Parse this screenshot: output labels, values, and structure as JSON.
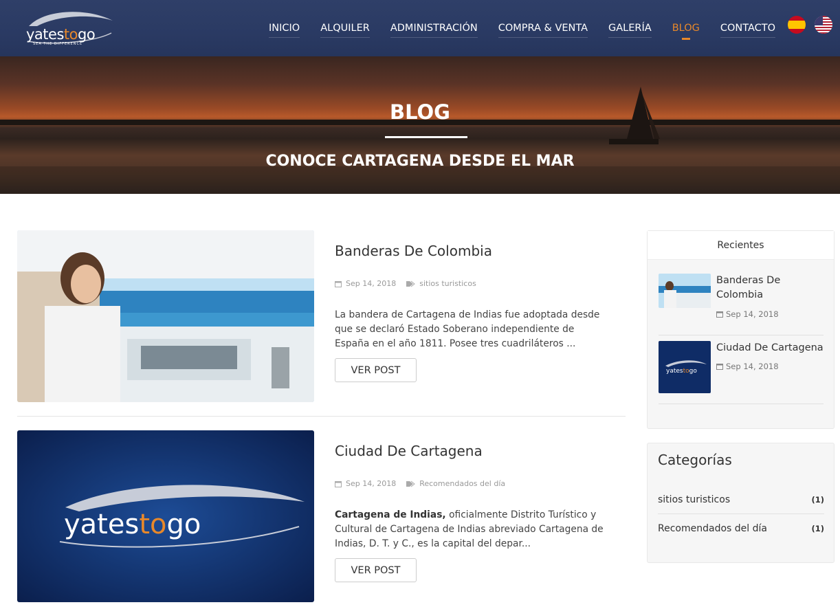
{
  "header": {
    "logo_main_a": "yates",
    "logo_main_b": "to",
    "logo_main_c": "go",
    "logo_tagline": "SEA THE DIFFERENCE",
    "nav": [
      {
        "label": "INICIO"
      },
      {
        "label": "ALQUILER"
      },
      {
        "label": "ADMINISTRACIÓN"
      },
      {
        "label": "COMPRA & VENTA"
      },
      {
        "label": "GALERÍA"
      },
      {
        "label": "BLOG"
      },
      {
        "label": "CONTACTO"
      }
    ],
    "active_nav": "BLOG",
    "accent_color": "#e8882a",
    "flags": [
      "spain-flag-icon",
      "usa-flag-icon"
    ]
  },
  "hero": {
    "title": "BLOG",
    "subtitle": "CONOCE CARTAGENA DESDE EL MAR"
  },
  "posts": [
    {
      "title": "Banderas De Colombia",
      "date": "Sep 14, 2018",
      "category": "sitios turisticos",
      "excerpt": "La bandera de Cartagena de Indias fue adoptada desde que se declaró Estado Soberano independiente de España en el año 1811. Posee tres cuadriláteros ...",
      "button": "VER POST"
    },
    {
      "title": "Ciudad De Cartagena",
      "date": "Sep 14, 2018",
      "category": "Recomendados del día",
      "excerpt_bold": "Cartagena de Indias,",
      "excerpt": " oficialmente Distrito Turístico y Cultural de Cartagena de Indias abreviado Cartagena de Indias, D. T. y C., es la capital del depar...",
      "button": "VER POST"
    }
  ],
  "sidebar": {
    "recent_heading": "Recientes",
    "recent": [
      {
        "title": "Banderas De Colombia",
        "date": "Sep 14, 2018"
      },
      {
        "title": "Ciudad De Cartagena",
        "date": "Sep 14, 2018"
      }
    ],
    "categories_heading": "Categorías",
    "categories": [
      {
        "name": "sitios turisticos",
        "count": "(1)"
      },
      {
        "name": "Recomendados del día",
        "count": "(1)"
      }
    ]
  }
}
